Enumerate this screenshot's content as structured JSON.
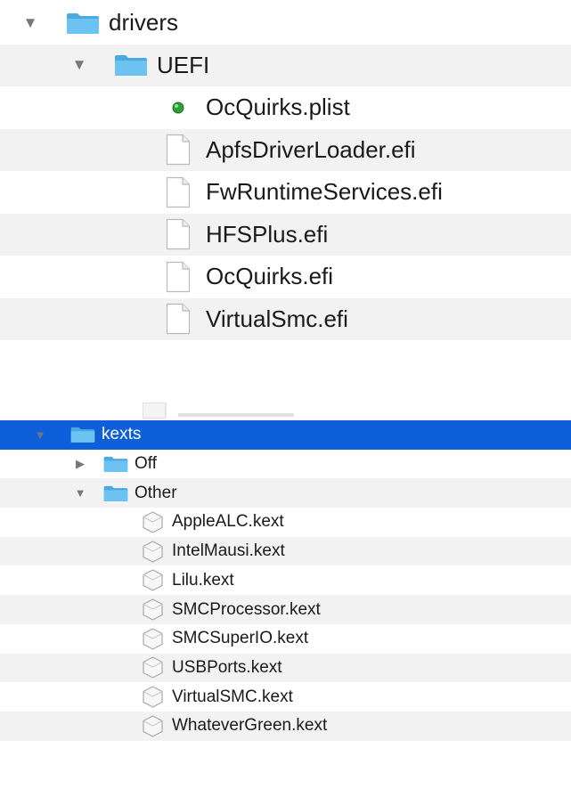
{
  "top_panel": {
    "drivers_folder": {
      "label": "drivers",
      "icon": "folder-icon",
      "expanded": true
    },
    "uefi_folder": {
      "label": "UEFI",
      "icon": "folder-icon",
      "expanded": true
    },
    "files": [
      {
        "label": "OcQuirks.plist",
        "icon": "plist-icon"
      },
      {
        "label": "ApfsDriverLoader.efi",
        "icon": "document-icon"
      },
      {
        "label": "FwRuntimeServices.efi",
        "icon": "document-icon"
      },
      {
        "label": "HFSPlus.efi",
        "icon": "document-icon"
      },
      {
        "label": "OcQuirks.efi",
        "icon": "document-icon"
      },
      {
        "label": "VirtualSmc.efi",
        "icon": "document-icon"
      }
    ]
  },
  "bottom_panel": {
    "kexts_folder": {
      "label": "kexts",
      "icon": "folder-icon",
      "expanded": true,
      "selected": true
    },
    "off_folder": {
      "label": "Off",
      "icon": "folder-icon",
      "expanded": false
    },
    "other_folder": {
      "label": "Other",
      "icon": "folder-icon",
      "expanded": true
    },
    "kexts": [
      {
        "label": "AppleALC.kext",
        "icon": "kext-icon"
      },
      {
        "label": "IntelMausi.kext",
        "icon": "kext-icon"
      },
      {
        "label": "Lilu.kext",
        "icon": "kext-icon"
      },
      {
        "label": "SMCProcessor.kext",
        "icon": "kext-icon"
      },
      {
        "label": "SMCSuperIO.kext",
        "icon": "kext-icon"
      },
      {
        "label": "USBPorts.kext",
        "icon": "kext-icon"
      },
      {
        "label": "VirtualSMC.kext",
        "icon": "kext-icon"
      },
      {
        "label": "WhateverGreen.kext",
        "icon": "kext-icon"
      }
    ]
  },
  "colors": {
    "selection": "#0f5fdb",
    "stripe": "#f2f2f2",
    "folder": "#5cb8ec",
    "folder_tab": "#7ccaf3",
    "plist_dot": "#2e9e3a"
  }
}
